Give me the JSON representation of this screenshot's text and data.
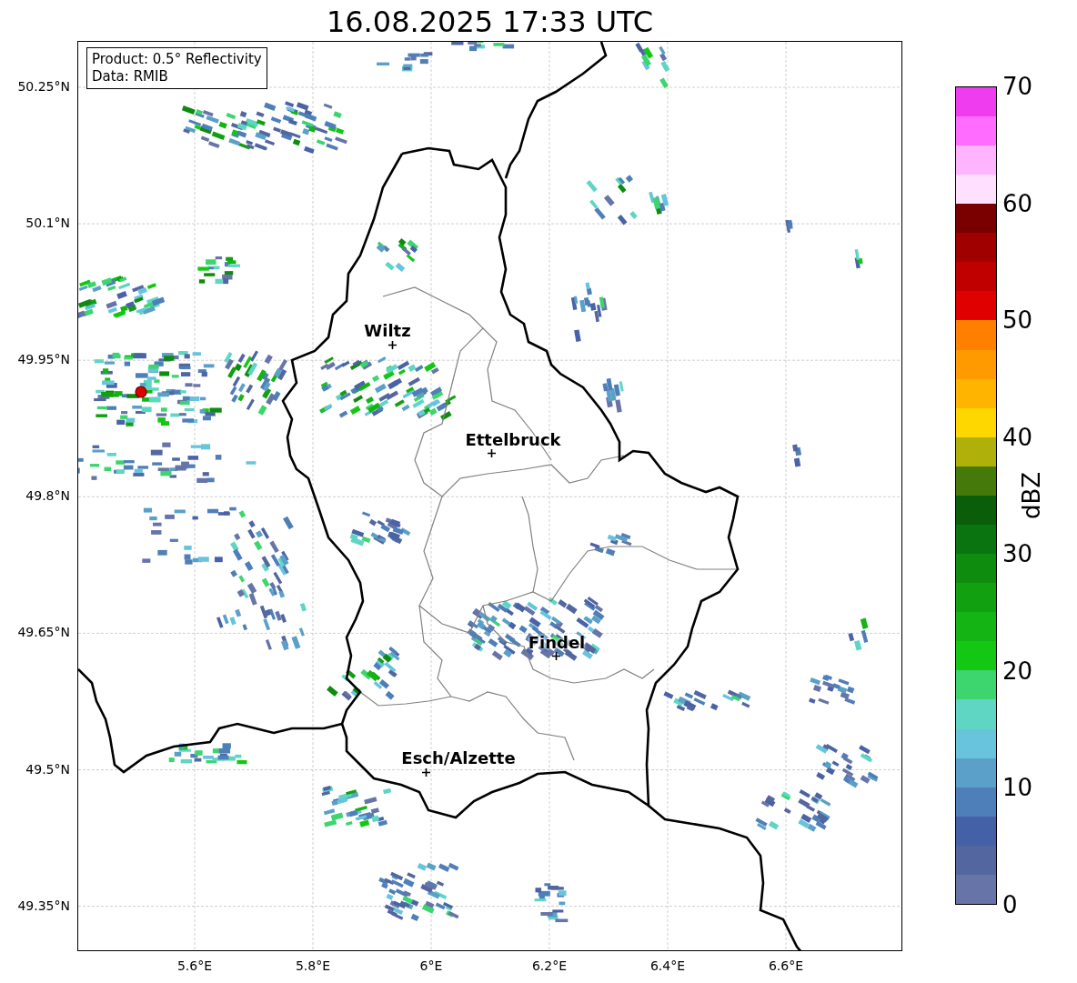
{
  "title": "16.08.2025 17:33 UTC",
  "info_box": [
    "Product: 0.5° Reflectivity",
    "Data: RMIB"
  ],
  "y_ticks": [
    "50.25°N",
    "50.1°N",
    "49.95°N",
    "49.8°N",
    "49.65°N",
    "49.5°N",
    "49.35°N"
  ],
  "x_ticks": [
    "5.6°E",
    "5.8°E",
    "6°E",
    "6.2°E",
    "6.4°E",
    "6.6°E"
  ],
  "cities": [
    {
      "name": "Wiltz"
    },
    {
      "name": "Ettelbruck"
    },
    {
      "name": "Findel"
    },
    {
      "name": "Esch/Alzette"
    }
  ],
  "colorbar": {
    "label": "dBZ",
    "ticks": [
      "70",
      "60",
      "50",
      "40",
      "30",
      "20",
      "10",
      "0"
    ],
    "segments": [
      {
        "color": "#6674a8"
      },
      {
        "color": "#5466a0"
      },
      {
        "color": "#4460a6"
      },
      {
        "color": "#4f7fb8"
      },
      {
        "color": "#5aa0c8"
      },
      {
        "color": "#68c4dc"
      },
      {
        "color": "#5fd6c4"
      },
      {
        "color": "#3dd56d"
      },
      {
        "color": "#13c813"
      },
      {
        "color": "#13b413"
      },
      {
        "color": "#10a010"
      },
      {
        "color": "#0e8c0e"
      },
      {
        "color": "#0a7410"
      },
      {
        "color": "#0a5e0a"
      },
      {
        "color": "#457a0a"
      },
      {
        "color": "#b0b00a"
      },
      {
        "color": "#ffd700"
      },
      {
        "color": "#ffb500"
      },
      {
        "color": "#ff9a00"
      },
      {
        "color": "#ff7f00"
      },
      {
        "color": "#e00000"
      },
      {
        "color": "#c00000"
      },
      {
        "color": "#a00000"
      },
      {
        "color": "#7a0000"
      },
      {
        "color": "#ffe0ff"
      },
      {
        "color": "#ffb4ff"
      },
      {
        "color": "#ff6cff"
      },
      {
        "color": "#ee3cee"
      }
    ]
  }
}
